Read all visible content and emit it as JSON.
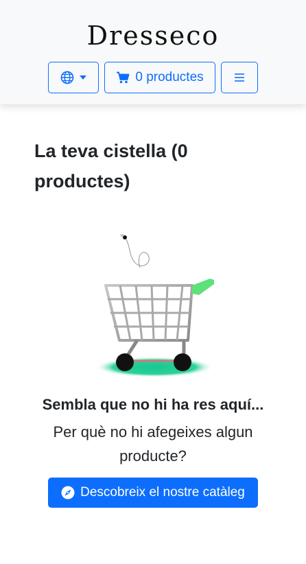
{
  "header": {
    "logo": "Dresseco",
    "language_icon": "globe-icon",
    "cart_label": "0 productes",
    "cart_icon": "shopping-cart-icon",
    "menu_icon": "hamburger-menu-icon"
  },
  "main": {
    "title": "La teva cistella (0 productes)",
    "empty_illustration": "empty-shopping-cart-illustration",
    "empty_heading": "Sembla que no hi ha res aquí...",
    "empty_subtext": "Per què no hi afegeixes algun producte?",
    "catalog_button": "Descobreix el nostre catàleg",
    "catalog_icon": "compass-icon"
  },
  "colors": {
    "primary": "#0d6efd",
    "header_bg": "#f8f9fa",
    "cart_handle": "#5ee07a",
    "cart_shadow": "#1fc98a"
  }
}
